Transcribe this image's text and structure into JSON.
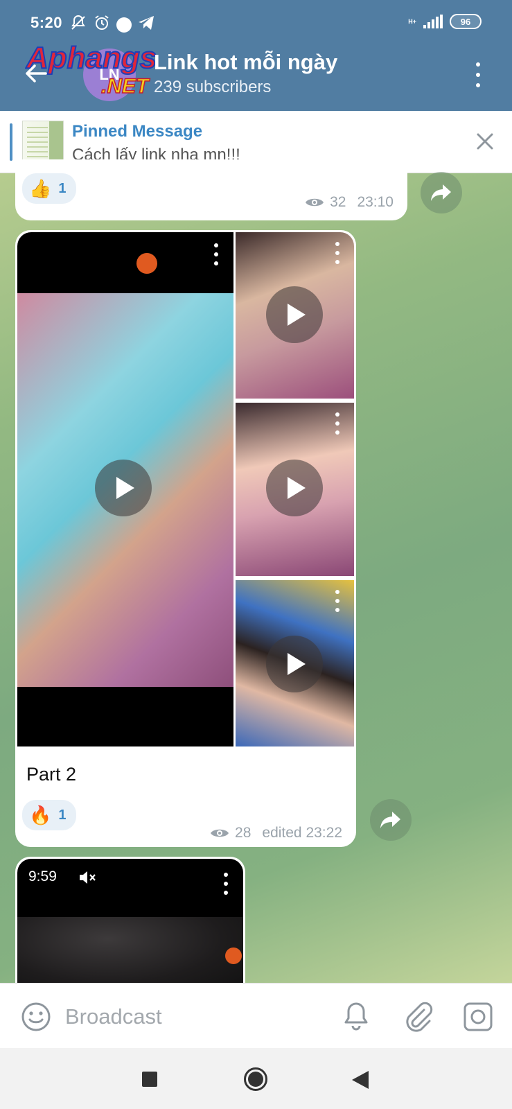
{
  "status_bar": {
    "time": "5:20",
    "battery": "96",
    "network": "H+"
  },
  "header": {
    "title": "Link hot mỗi ngày",
    "subtitle": "239 subscribers",
    "avatar_text": "LN",
    "watermark_text_top": "Aphangs",
    "watermark_text_bottom": ".NET"
  },
  "pinned": {
    "label": "Pinned Message",
    "text": "Cách lấy link nha mn!!!"
  },
  "messages": [
    {
      "reaction_emoji": "👍",
      "reaction_count": "1",
      "views": "32",
      "time": "23:10"
    },
    {
      "caption": "Part 2",
      "reaction_emoji": "🔥",
      "reaction_count": "1",
      "views": "28",
      "time": "edited 23:22"
    },
    {
      "video_time": "9:59"
    }
  ],
  "input": {
    "placeholder": "Broadcast"
  },
  "colors": {
    "header": "#517da2",
    "accent": "#3b87c4",
    "bubble": "#ffffff"
  }
}
